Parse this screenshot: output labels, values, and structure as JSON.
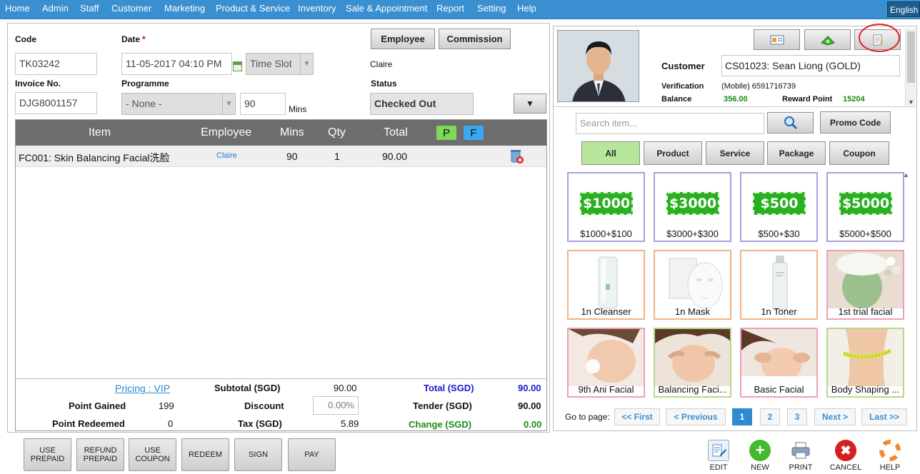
{
  "nav": {
    "items": [
      "Home",
      "Admin",
      "Staff",
      "Customer",
      "Marketing",
      "Product & Service",
      "Inventory",
      "Sale & Appointment",
      "Report",
      "Setting",
      "Help"
    ],
    "language": "English"
  },
  "form": {
    "code_label": "Code",
    "code_value": "TK03242",
    "date_label": "Date",
    "required_mark": "*",
    "date_value": "11-05-2017 04:10 PM",
    "timeslot_placeholder": "Time Slot",
    "invoice_label": "Invoice No.",
    "invoice_value": "DJG8001157",
    "programme_label": "Programme",
    "programme_value": "- None -",
    "duration_value": "90",
    "duration_unit": "Mins",
    "employee_button": "Employee",
    "commission_button": "Commission",
    "employee_name": "Claire",
    "status_label": "Status",
    "status_value": "Checked Out"
  },
  "table": {
    "headers": {
      "item": "Item",
      "employee": "Employee",
      "mins": "Mins",
      "qty": "Qty",
      "total": "Total",
      "p": "P",
      "f": "F"
    },
    "rows": [
      {
        "item": "FC001: Skin Balancing Facial洗脸",
        "employee": "Claire",
        "mins": "90",
        "qty": "1",
        "total": "90.00"
      }
    ]
  },
  "summary": {
    "pricing_link": "Pricing : VIP",
    "point_gained_label": "Point Gained",
    "point_gained_value": "199",
    "point_redeemed_label": "Point Redeemed",
    "point_redeemed_value": "0",
    "subtotal_label": "Subtotal (SGD)",
    "subtotal_value": "90.00",
    "discount_label": "Discount",
    "discount_value": "0.00%",
    "tax_label": "Tax (SGD)",
    "tax_value": "5.89",
    "total_label": "Total (SGD)",
    "total_value": "90.00",
    "tender_label": "Tender (SGD)",
    "tender_value": "90.00",
    "change_label": "Change (SGD)",
    "change_value": "0.00"
  },
  "bottom_buttons": {
    "use_prepaid": "USE PREPAID",
    "refund_prepaid": "REFUND PREPAID",
    "use_coupon": "USE COUPON",
    "redeem": "REDEEM",
    "sign": "SIGN",
    "pay": "PAY"
  },
  "customer": {
    "label": "Customer",
    "value": "CS01023: Sean Liong (GOLD)",
    "verification_label": "Verification",
    "verification_value": "(Mobile) 6591716739",
    "balance_label": "Balance",
    "balance_value": "356.00",
    "reward_label": "Reward Point",
    "reward_value": "15204"
  },
  "search": {
    "placeholder": "Search item...",
    "promo_button": "Promo Code"
  },
  "filters": [
    "All",
    "Product",
    "Service",
    "Package",
    "Coupon"
  ],
  "items": [
    {
      "badge": "$1000",
      "caption": "$1000+$100",
      "border": "#a7a0dc"
    },
    {
      "badge": "$3000",
      "caption": "$3000+$300",
      "border": "#a7a0dc"
    },
    {
      "badge": "$500",
      "caption": "$500+$30",
      "border": "#a7a0dc"
    },
    {
      "badge": "$5000",
      "caption": "$5000+$500",
      "border": "#a7a0dc"
    },
    {
      "caption": "1n Cleanser",
      "border": "#f0b487"
    },
    {
      "caption": "1n Mask",
      "border": "#f0b487"
    },
    {
      "caption": "1n Toner",
      "border": "#f0b487"
    },
    {
      "caption": "1st trial facial",
      "border": "#ee9fb8"
    },
    {
      "caption": "9th Ani Facial",
      "border": "#ee9fb8"
    },
    {
      "caption": "Balancing Faci...",
      "border": "#b6d88a"
    },
    {
      "caption": "Basic Facial",
      "border": "#ee9fb8"
    },
    {
      "caption": "Body Shaping ...",
      "border": "#b6d88a"
    }
  ],
  "pagination": {
    "goto_label": "Go to page:",
    "first": "<< First",
    "previous": "< Previous",
    "pages": [
      "1",
      "2",
      "3"
    ],
    "next": "Next >",
    "last": "Last >>",
    "current": "1"
  },
  "actions": {
    "edit": "EDIT",
    "new": "NEW",
    "print": "PRINT",
    "cancel": "CANCEL",
    "help": "HELP"
  },
  "colors": {
    "nav": "#3a8fd0",
    "blue_total": "#1a1acc",
    "green_change": "#1a8a1a",
    "p_badge": "#7ed957",
    "f_badge": "#3aaaf0",
    "all_filter": "#b7e59a"
  }
}
